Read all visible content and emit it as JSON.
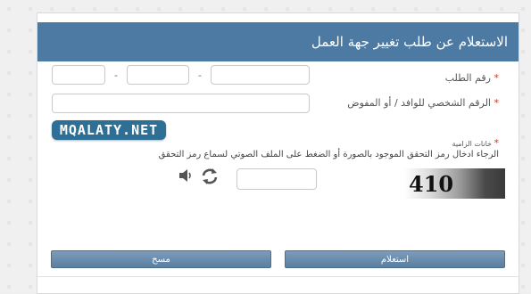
{
  "header": {
    "title": "الاستعلام عن طلب تغيير جهة العمل"
  },
  "form": {
    "request_number": {
      "required_mark": "*",
      "label": "رقم الطلب",
      "separator1": "-",
      "separator2": "-"
    },
    "id_number": {
      "required_mark": "*",
      "label": "الرقم الشخصي للوافد / أو المفوض"
    },
    "captcha": {
      "required_mark": "*",
      "note": "خانات الزامية",
      "instructions": "الرجاء ادخال رمز التحقق الموجود بالصورة أو الضغط على الملف الصوتي لسماع رمز التحقق",
      "code": "410"
    }
  },
  "watermark": "MQALATY.NET",
  "icons": {
    "audio": "speaker-icon",
    "refresh": "refresh-icon"
  },
  "buttons": {
    "query": "استعلام",
    "clear": "مسح"
  },
  "colors": {
    "header": "#4c7aa3",
    "button": "#5b7f9f",
    "required": "#c0392b"
  }
}
